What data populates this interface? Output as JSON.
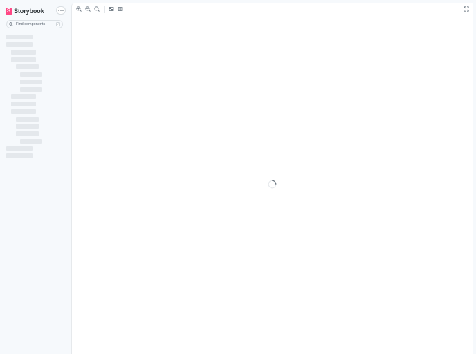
{
  "sidebar": {
    "brand": {
      "logo_letter": "S",
      "name": "Storybook"
    },
    "menu_button_icon": "ellipsis-icon",
    "search": {
      "placeholder": "Find components",
      "shortcut": "/"
    },
    "tree_loading": true
  },
  "toolbar": {
    "tools": [
      {
        "name": "zoom-in",
        "icon": "zoom-in-icon"
      },
      {
        "name": "zoom-out",
        "icon": "zoom-out-icon"
      },
      {
        "name": "zoom-reset",
        "icon": "zoom-reset-icon"
      },
      {
        "name": "background",
        "icon": "background-grid-icon"
      },
      {
        "name": "grid",
        "icon": "grid-icon"
      }
    ],
    "fullscreen_icon": "fullscreen-icon"
  },
  "preview": {
    "loading": true
  },
  "colors": {
    "brand": "#FF4785",
    "sidebar_bg": "#F6F9FC",
    "skeleton": "#E4E8EC",
    "icon": "#6B7680"
  }
}
